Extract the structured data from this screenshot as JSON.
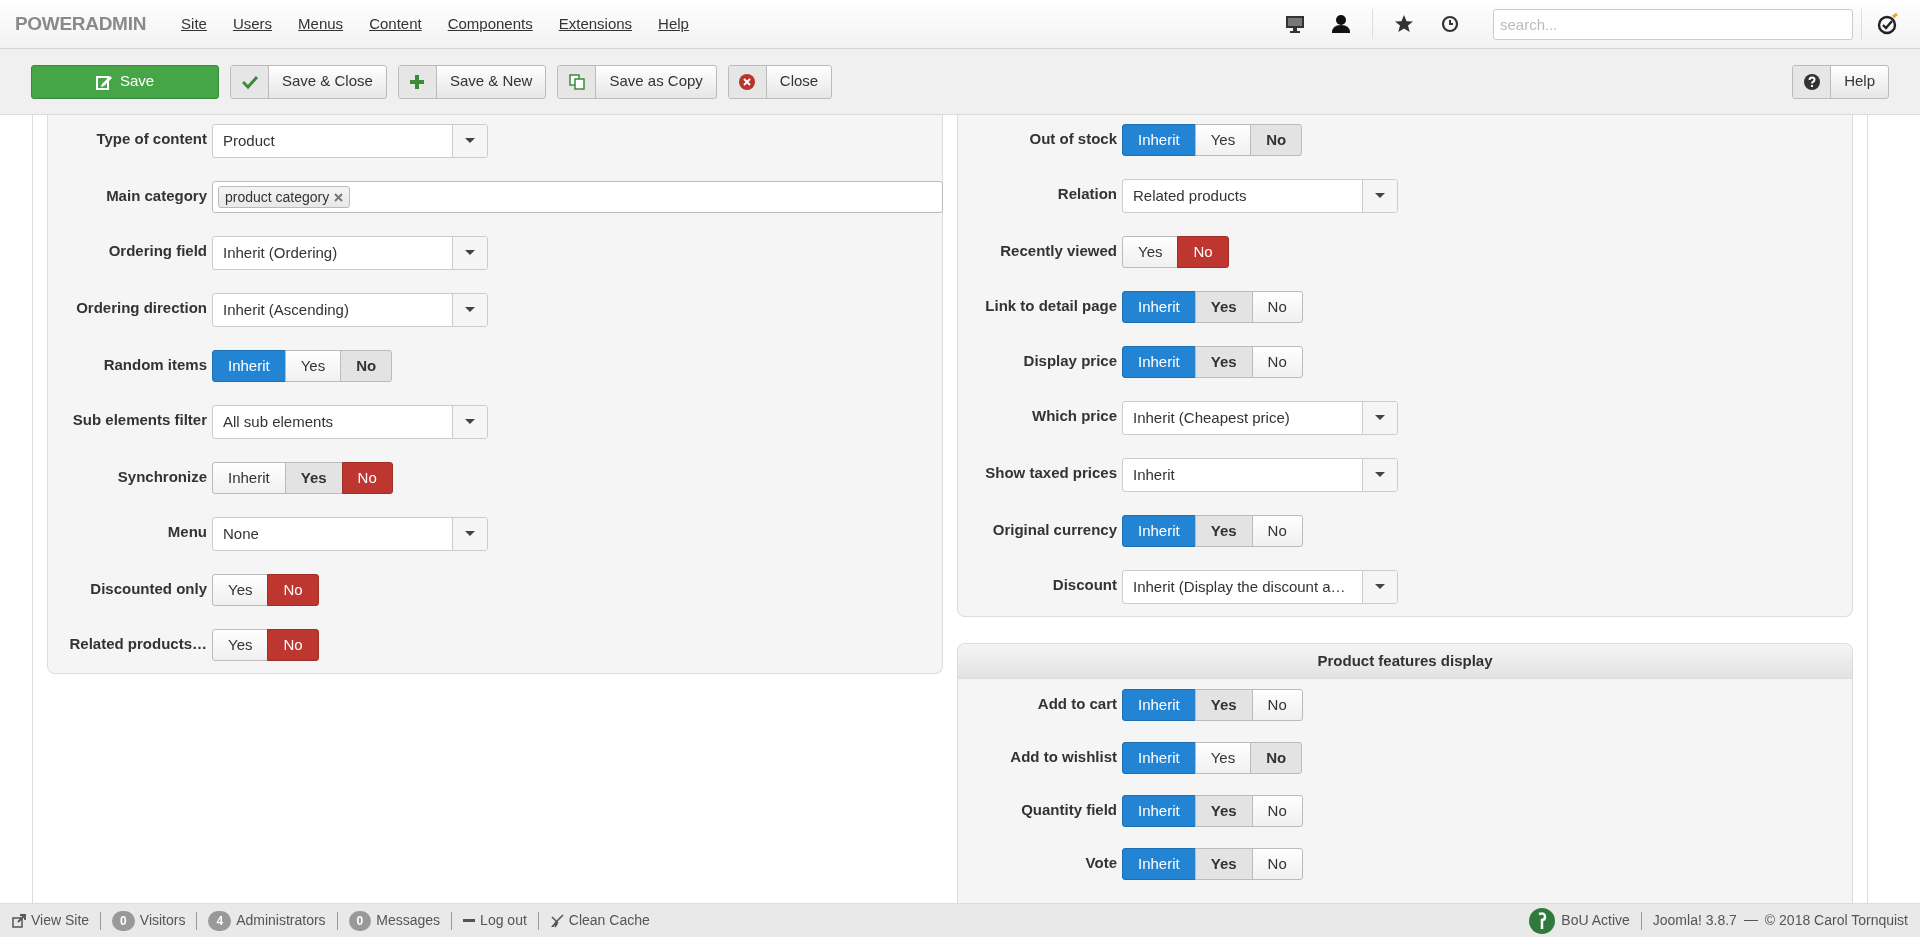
{
  "navbar": {
    "brand": "**POWER**ADMIN",
    "menu": [
      "Site",
      "Users",
      "Menus",
      "Content",
      "Components",
      "Extensions",
      "Help"
    ],
    "search": {
      "placeholder": "search..."
    }
  },
  "toolbar": {
    "buttons": [
      {
        "label": "Save",
        "kind": "save"
      },
      {
        "label": "Save & Close",
        "kind": "save-close"
      },
      {
        "label": "Save & New",
        "kind": "save-new"
      },
      {
        "label": "Save as Copy",
        "kind": "copy"
      },
      {
        "label": "Close",
        "kind": "close"
      }
    ],
    "help_button": {
      "label": "Help",
      "kind": "help"
    }
  },
  "left_panel": {
    "fields": [
      {
        "label": "Type of content",
        "kind": "select",
        "value": "Product"
      },
      {
        "label": "Main category",
        "kind": "tags",
        "tags": [
          "product category"
        ]
      },
      {
        "label": "Ordering field",
        "kind": "select",
        "value": "Inherit (Ordering)"
      },
      {
        "label": "Ordering direction",
        "kind": "select",
        "value": "Inherit (Ascending)"
      },
      {
        "label": "Random items",
        "kind": "toggle",
        "options": [
          {
            "label": "Inherit",
            "selected": true,
            "inherited": false
          },
          {
            "label": "Yes",
            "selected": false,
            "inherited": false
          },
          {
            "label": "No",
            "selected": false,
            "inherited": true
          }
        ]
      },
      {
        "label": "Sub elements filter",
        "kind": "select",
        "value": "All sub elements"
      },
      {
        "label": "Synchronize",
        "kind": "toggle",
        "options": [
          {
            "label": "Inherit",
            "selected": false,
            "inherited": false
          },
          {
            "label": "Yes",
            "selected": false,
            "inherited": true
          },
          {
            "label": "No",
            "selected": true,
            "inherited": false
          }
        ]
      },
      {
        "label": "Menu",
        "kind": "select",
        "value": "None"
      },
      {
        "label": "Discounted only",
        "kind": "toggle",
        "options": [
          {
            "label": "Yes",
            "selected": false,
            "inherited": false
          },
          {
            "label": "No",
            "selected": true,
            "inherited": false
          }
        ]
      },
      {
        "label": "Related products…",
        "kind": "toggle",
        "options": [
          {
            "label": "Yes",
            "selected": false,
            "inherited": false
          },
          {
            "label": "No",
            "selected": true,
            "inherited": false
          }
        ]
      }
    ]
  },
  "right_panel": {
    "fields": [
      {
        "label": "Out of stock",
        "kind": "toggle",
        "options": [
          {
            "label": "Inherit",
            "selected": true,
            "inherited": false
          },
          {
            "label": "Yes",
            "selected": false,
            "inherited": false
          },
          {
            "label": "No",
            "selected": false,
            "inherited": true
          }
        ]
      },
      {
        "label": "Relation",
        "kind": "select",
        "value": "Related products"
      },
      {
        "label": "Recently viewed",
        "kind": "toggle",
        "options": [
          {
            "label": "Yes",
            "selected": false,
            "inherited": false
          },
          {
            "label": "No",
            "selected": true,
            "inherited": false
          }
        ]
      },
      {
        "label": "Link to detail page",
        "kind": "toggle",
        "options": [
          {
            "label": "Inherit",
            "selected": true,
            "inherited": false
          },
          {
            "label": "Yes",
            "selected": false,
            "inherited": true
          },
          {
            "label": "No",
            "selected": false,
            "inherited": false
          }
        ]
      },
      {
        "label": "Display price",
        "kind": "toggle",
        "options": [
          {
            "label": "Inherit",
            "selected": true,
            "inherited": false
          },
          {
            "label": "Yes",
            "selected": false,
            "inherited": true
          },
          {
            "label": "No",
            "selected": false,
            "inherited": false
          }
        ]
      },
      {
        "label": "Which price",
        "kind": "select",
        "value": "Inherit (Cheapest price)"
      },
      {
        "label": "Show taxed prices",
        "kind": "select",
        "value": "Inherit"
      },
      {
        "label": "Original currency",
        "kind": "toggle",
        "options": [
          {
            "label": "Inherit",
            "selected": true,
            "inherited": false
          },
          {
            "label": "Yes",
            "selected": false,
            "inherited": true
          },
          {
            "label": "No",
            "selected": false,
            "inherited": false
          }
        ]
      },
      {
        "label": "Discount",
        "kind": "select",
        "value": "Inherit (Display the discount a…"
      }
    ]
  },
  "features_panel": {
    "title": "Product features display",
    "fields": [
      {
        "label": "Add to cart",
        "kind": "toggle",
        "options": [
          {
            "label": "Inherit",
            "selected": true,
            "inherited": false
          },
          {
            "label": "Yes",
            "selected": false,
            "inherited": true
          },
          {
            "label": "No",
            "selected": false,
            "inherited": false
          }
        ]
      },
      {
        "label": "Add to wishlist",
        "kind": "toggle",
        "options": [
          {
            "label": "Inherit",
            "selected": true,
            "inherited": false
          },
          {
            "label": "Yes",
            "selected": false,
            "inherited": false
          },
          {
            "label": "No",
            "selected": false,
            "inherited": true
          }
        ]
      },
      {
        "label": "Quantity field",
        "kind": "toggle",
        "options": [
          {
            "label": "Inherit",
            "selected": true,
            "inherited": false
          },
          {
            "label": "Yes",
            "selected": false,
            "inherited": true
          },
          {
            "label": "No",
            "selected": false,
            "inherited": false
          }
        ]
      },
      {
        "label": "Vote",
        "kind": "toggle",
        "options": [
          {
            "label": "Inherit",
            "selected": true,
            "inherited": false
          },
          {
            "label": "Yes",
            "selected": false,
            "inherited": true
          },
          {
            "label": "No",
            "selected": false,
            "inherited": false
          }
        ]
      }
    ]
  },
  "status_bar": {
    "left": [
      {
        "kind": "view-site",
        "label": "View Site"
      },
      {
        "kind": "count",
        "count": "0",
        "label": "Visitors"
      },
      {
        "kind": "count",
        "count": "4",
        "label": "Administrators"
      },
      {
        "kind": "count",
        "count": "0",
        "label": "Messages"
      },
      {
        "kind": "logout",
        "label": "Log out"
      },
      {
        "kind": "clean-cache",
        "label": "Clean Cache"
      }
    ],
    "status": "BoU Active",
    "version": "Joomla! 3.8.7",
    "copyright": "© 2018 Carol Tornquist"
  }
}
